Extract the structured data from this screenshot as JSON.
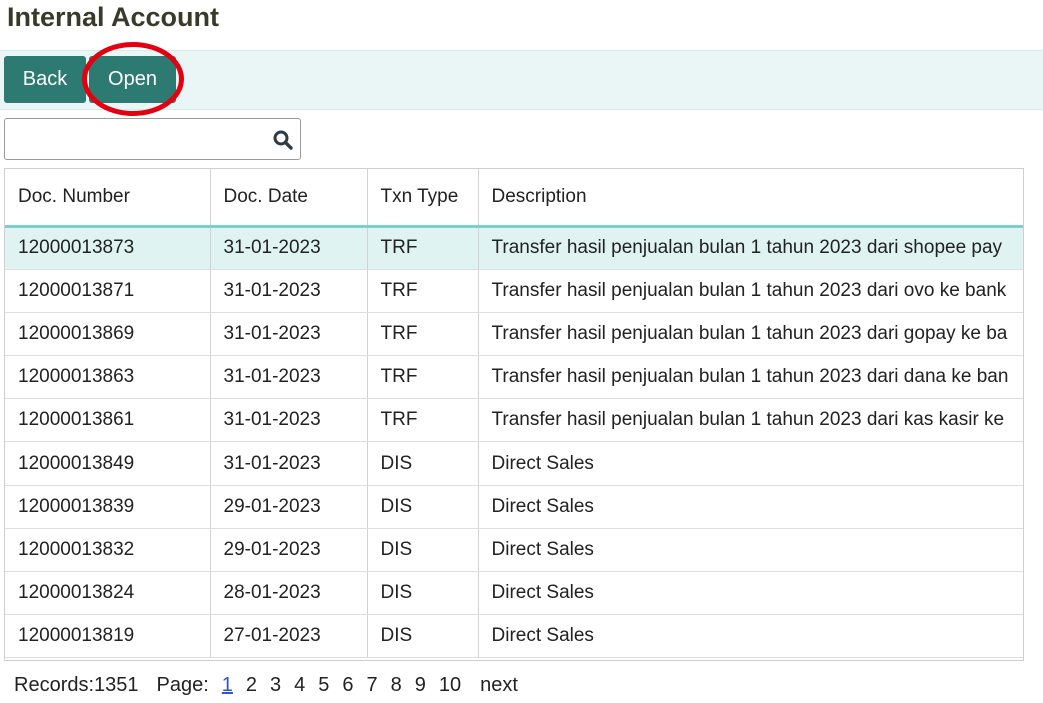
{
  "page": {
    "title": "Internal Account"
  },
  "toolbar": {
    "back_label": "Back",
    "open_label": "Open",
    "accent_color": "#2d7a73",
    "highlight_color": "#e3000f"
  },
  "search": {
    "value": "",
    "placeholder": "",
    "icon": "search-icon"
  },
  "table": {
    "columns": [
      "Doc. Number",
      "Doc. Date",
      "Txn Type",
      "Description"
    ],
    "rows": [
      [
        "12000013873",
        "31-01-2023",
        "TRF",
        "Transfer hasil penjualan bulan 1 tahun 2023 dari shopee pay"
      ],
      [
        "12000013871",
        "31-01-2023",
        "TRF",
        "Transfer hasil penjualan bulan 1 tahun 2023 dari ovo ke bank"
      ],
      [
        "12000013869",
        "31-01-2023",
        "TRF",
        "Transfer hasil penjualan bulan 1 tahun 2023 dari gopay ke ba"
      ],
      [
        "12000013863",
        "31-01-2023",
        "TRF",
        "Transfer hasil penjualan bulan 1 tahun 2023 dari dana ke ban"
      ],
      [
        "12000013861",
        "31-01-2023",
        "TRF",
        "Transfer hasil penjualan bulan 1 tahun 2023 dari kas kasir ke"
      ],
      [
        "12000013849",
        "31-01-2023",
        "DIS",
        "Direct Sales"
      ],
      [
        "12000013839",
        "29-01-2023",
        "DIS",
        "Direct Sales"
      ],
      [
        "12000013832",
        "29-01-2023",
        "DIS",
        "Direct Sales"
      ],
      [
        "12000013824",
        "28-01-2023",
        "DIS",
        "Direct Sales"
      ],
      [
        "12000013819",
        "27-01-2023",
        "DIS",
        "Direct Sales"
      ]
    ],
    "selected_row": 0
  },
  "pager": {
    "records_label": "Records:",
    "records_count": "1351",
    "page_label": "Page:",
    "pages": [
      "1",
      "2",
      "3",
      "4",
      "5",
      "6",
      "7",
      "8",
      "9",
      "10"
    ],
    "current_page": "1",
    "next_label": "next"
  }
}
